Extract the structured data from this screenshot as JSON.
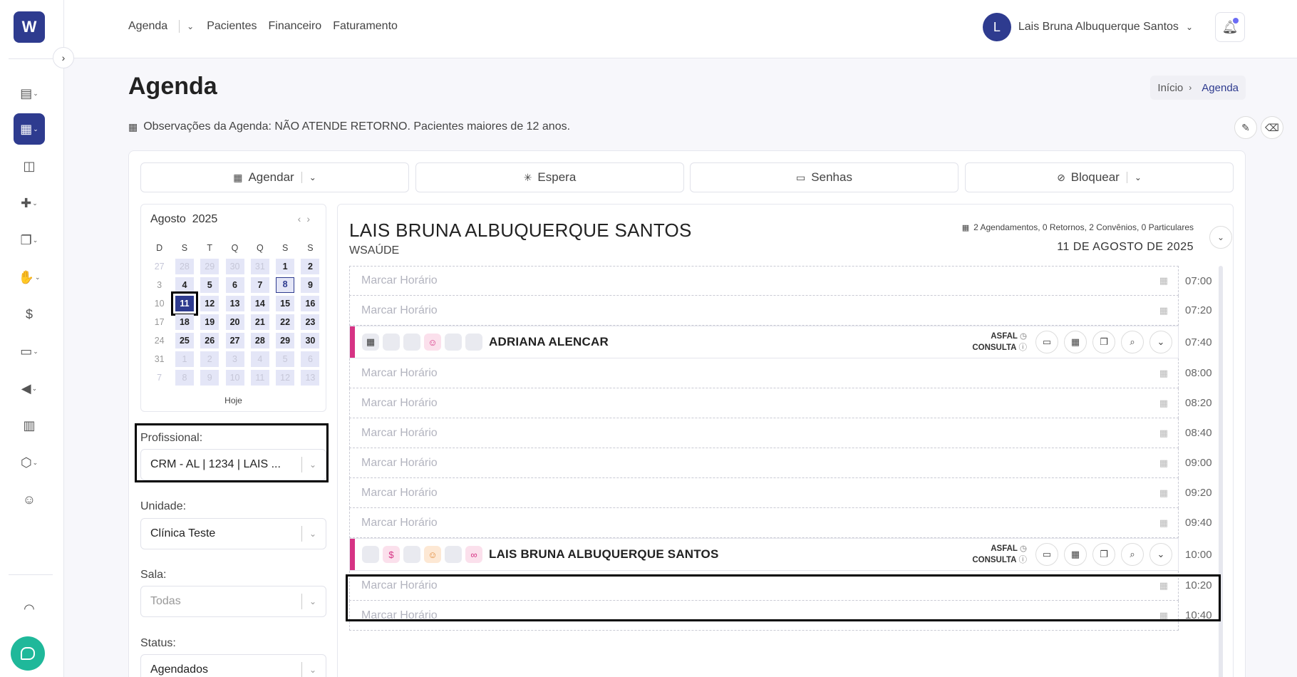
{
  "app": {
    "logo_letter": "W"
  },
  "topnav": {
    "agenda": "Agenda",
    "pacientes": "Pacientes",
    "financeiro": "Financeiro",
    "faturamento": "Faturamento"
  },
  "user": {
    "initial": "L",
    "name": "Lais Bruna Albuquerque Santos"
  },
  "page": {
    "title": "Agenda",
    "breadcrumb": {
      "home": "Início",
      "current": "Agenda"
    },
    "observations": "Observações da Agenda: NÃO ATENDE RETORNO. Pacientes maiores de 12 anos."
  },
  "actions": {
    "agendar": "Agendar",
    "espera": "Espera",
    "senhas": "Senhas",
    "bloquear": "Bloquear"
  },
  "calendar": {
    "month": "Agosto",
    "year": "2025",
    "weekdays": [
      "D",
      "S",
      "T",
      "Q",
      "Q",
      "S",
      "S"
    ],
    "today_label": "Hoje",
    "weeks": [
      [
        "27",
        "28",
        "29",
        "30",
        "31",
        "1",
        "2"
      ],
      [
        "3",
        "4",
        "5",
        "6",
        "7",
        "8",
        "9"
      ],
      [
        "10",
        "11",
        "12",
        "13",
        "14",
        "15",
        "16"
      ],
      [
        "17",
        "18",
        "19",
        "20",
        "21",
        "22",
        "23"
      ],
      [
        "24",
        "25",
        "26",
        "27",
        "28",
        "29",
        "30"
      ],
      [
        "31",
        "1",
        "2",
        "3",
        "4",
        "5",
        "6"
      ],
      [
        "7",
        "8",
        "9",
        "10",
        "11",
        "12",
        "13"
      ]
    ],
    "selected_day": "11",
    "today_day": "8"
  },
  "filters": {
    "profissional": {
      "label": "Profissional:",
      "value": "CRM - AL | 1234 | LAIS ..."
    },
    "unidade": {
      "label": "Unidade:",
      "value": "Clínica Teste"
    },
    "sala": {
      "label": "Sala:",
      "value": "Todas"
    },
    "status": {
      "label": "Status:",
      "value": "Agendados"
    }
  },
  "agenda": {
    "professional": "LAIS BRUNA ALBUQUERQUE SANTOS",
    "subtitle": "WSAÚDE",
    "stats": "2 Agendamentos, 0 Retornos, 2 Convênios, 0 Particulares",
    "date": "11 DE AGOSTO DE 2025",
    "placeholder": "Marcar Horário",
    "slots": [
      {
        "time": "07:00",
        "type": "empty"
      },
      {
        "time": "07:20",
        "type": "empty"
      },
      {
        "time": "07:40",
        "type": "appt",
        "patient": "ADRIANA ALENCAR",
        "plan": "ASFAL",
        "kind": "CONSULTA"
      },
      {
        "time": "08:00",
        "type": "empty"
      },
      {
        "time": "08:20",
        "type": "empty"
      },
      {
        "time": "08:40",
        "type": "empty"
      },
      {
        "time": "09:00",
        "type": "empty"
      },
      {
        "time": "09:20",
        "type": "empty"
      },
      {
        "time": "09:40",
        "type": "empty"
      },
      {
        "time": "10:00",
        "type": "appt",
        "patient": "LAIS BRUNA ALBUQUERQUE SANTOS",
        "plan": "ASFAL",
        "kind": "CONSULTA"
      },
      {
        "time": "10:20",
        "type": "empty"
      },
      {
        "time": "10:40",
        "type": "empty"
      }
    ]
  },
  "colors": {
    "brand": "#2e3b8f",
    "appt_bar": "#d63384",
    "chat": "#1fb89a"
  }
}
